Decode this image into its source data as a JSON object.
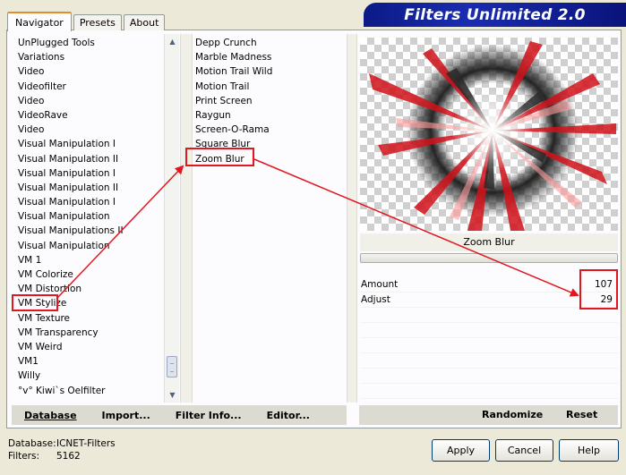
{
  "app_title": "Filters Unlimited 2.0",
  "tabs": [
    {
      "label": "Navigator",
      "active": true
    },
    {
      "label": "Presets",
      "active": false
    },
    {
      "label": "About",
      "active": false
    }
  ],
  "categories": [
    "UnPlugged Tools",
    "Variations",
    "Video",
    "Videofilter",
    "Video",
    "VideoRave",
    "Video",
    "Visual Manipulation I",
    "Visual Manipulation II",
    "Visual Manipulation I",
    "Visual Manipulation II",
    "Visual Manipulation I",
    "Visual Manipulation",
    "Visual Manipulations II",
    "Visual Manipulation",
    "VM 1",
    "VM Colorize",
    "VM Distortion",
    "VM Stylize",
    "VM Texture",
    "VM Transparency",
    "VM Weird",
    "VM1",
    "Willy",
    "°v° Kiwi`s Oelfilter"
  ],
  "selected_category": "VM Stylize",
  "filters": [
    "Depp Crunch",
    "Marble Madness",
    "Motion Trail Wild",
    "Motion Trail",
    "Print Screen",
    "Raygun",
    "Screen-O-Rama",
    "Square Blur",
    "Zoom Blur"
  ],
  "selected_filter": "Zoom Blur",
  "preview_label": "Zoom Blur",
  "params": [
    {
      "label": "Amount",
      "value": "107"
    },
    {
      "label": "Adjust",
      "value": "29"
    }
  ],
  "left_buttons": {
    "database": "Database",
    "import": "Import...",
    "filter_info": "Filter Info...",
    "editor": "Editor..."
  },
  "right_buttons": {
    "randomize": "Randomize",
    "reset": "Reset"
  },
  "status": {
    "database_label": "Database:",
    "database_value": "ICNET-Filters",
    "filters_label": "Filters:",
    "filters_value": "5162"
  },
  "dialog_buttons": {
    "apply": "Apply",
    "cancel": "Cancel",
    "help": "Help"
  },
  "colors": {
    "annotation_red": "#e1161f",
    "banner_blue": "#1a2db0",
    "tab_orange": "#e68b2c"
  },
  "icons": {
    "scroll_up": "▲",
    "scroll_down": "▼"
  }
}
